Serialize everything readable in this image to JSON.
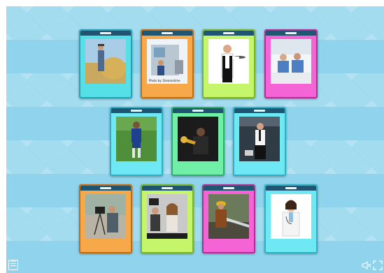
{
  "game": {
    "cards": [
      {
        "name": "card-farmer",
        "photo": "farmer-photo",
        "color": "cyan"
      },
      {
        "name": "card-truck-driver",
        "photo": "truck-driver-photo",
        "color": "orange",
        "caption": "Photo by: Dreamstime"
      },
      {
        "name": "card-waiter",
        "photo": "waiter-photo",
        "color": "green"
      },
      {
        "name": "card-nurses",
        "photo": "nurses-photo",
        "color": "pink"
      },
      {
        "name": "card-football-player",
        "photo": "football-player-photo",
        "color": "sky"
      },
      {
        "name": "card-musician",
        "photo": "musician-photo",
        "color": "mint"
      },
      {
        "name": "card-flight-attendant",
        "photo": "flight-attendant-photo",
        "color": "sky"
      },
      {
        "name": "card-cameraman",
        "photo": "cameraman-photo",
        "color": "orange"
      },
      {
        "name": "card-reporter",
        "photo": "reporter-photo",
        "color": "green"
      },
      {
        "name": "card-firefighter",
        "photo": "firefighter-photo",
        "color": "pink"
      },
      {
        "name": "card-doctor",
        "photo": "doctor-photo",
        "color": "sky"
      }
    ]
  },
  "controls": {
    "menu_icon": "menu-icon",
    "mute_icon": "speaker-muted-icon",
    "fullscreen_icon": "fullscreen-icon",
    "menu_glyph": "☰",
    "mute_glyph": "🔇",
    "fullscreen_glyph": "⤡"
  },
  "colors": {
    "background": "#8fd4ec",
    "card_bar": "#1f5570"
  }
}
